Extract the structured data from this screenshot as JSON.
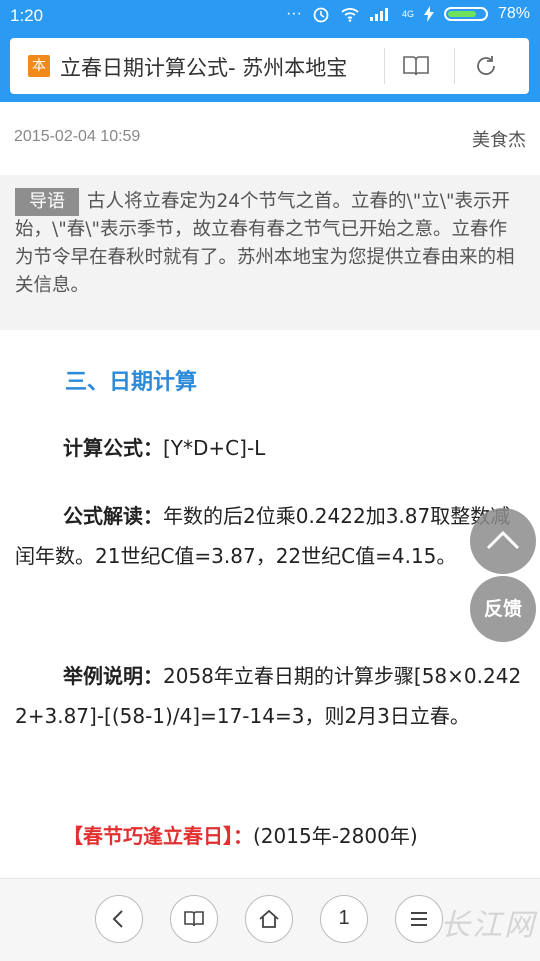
{
  "status_bar": {
    "time": "1:20",
    "battery": "78%",
    "battery_level": 0.78,
    "network": "4G"
  },
  "browser": {
    "page_title": "立春日期计算公式- 苏州本地宝",
    "site_icon_text": "本"
  },
  "article": {
    "date": "2015-02-04 10:59",
    "author": "美食杰",
    "intro_tag": "导语",
    "intro_text": "古人将立春定为24个节气之首。立春的\\\"立\\\"表示开始，\\\"春\\\"表示季节，故立春有春之节气已开始之意。立春作为节令早在春秋时就有了。苏州本地宝为您提供立春由来的相关信息。",
    "section_heading": "三、日期计算",
    "formula_label": "计算公式：",
    "formula_value": "[Y*D+C]-L",
    "explain_label": "公式解读：",
    "explain_value": "年数的后2位乘0.2422加3.87取整数减闰年数。21世纪C值=3.87，22世纪C值=4.15。",
    "example_label": "举例说明：",
    "example_value": "2058年立春日期的计算步骤[58×0.2422+3.87]-[(58-1)/4]=17-14=3，则2月3日立春。",
    "festival_label": "【春节巧逢立春日】：",
    "festival_value": "(2015年-2800年)"
  },
  "float_buttons": {
    "feedback_label": "反馈"
  },
  "bottom_nav": {
    "page_number": "1"
  },
  "watermark": "长江网"
}
